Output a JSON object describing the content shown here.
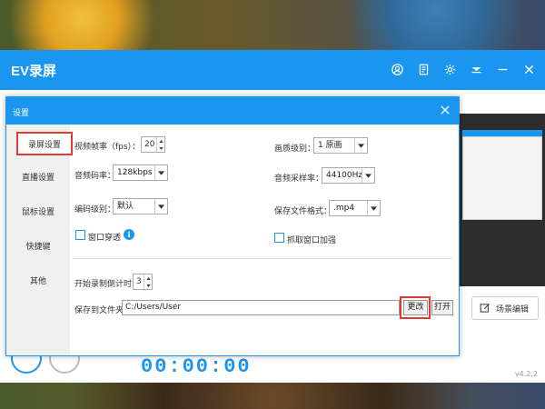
{
  "app": {
    "title": "EV录屏",
    "version": "v4.2.2",
    "scene_edit_label": "场景编辑",
    "timer": "00:00:00"
  },
  "dialog": {
    "title": "设置",
    "sidebar": [
      {
        "label": "录屏设置",
        "active": true
      },
      {
        "label": "直播设置",
        "active": false
      },
      {
        "label": "鼠标设置",
        "active": false
      },
      {
        "label": "快捷键",
        "active": false
      },
      {
        "label": "其他",
        "active": false
      }
    ],
    "fps": {
      "label": "视频帧率（fps）：",
      "value": "20"
    },
    "quality": {
      "label": "画质级别：",
      "value": "1 原画"
    },
    "audio_bitrate": {
      "label": "音频码率：",
      "value": "128kbps"
    },
    "sample_rate": {
      "label": "音频采样率：",
      "value": "44100Hz"
    },
    "encode_level": {
      "label": "编码级别：",
      "value": "默认"
    },
    "file_format": {
      "label": "保存文件格式：",
      "value": ".mp4"
    },
    "window_through": {
      "label": "窗口穿透",
      "checked": false
    },
    "capture_enhance": {
      "label": "抓取窗口加强",
      "checked": false
    },
    "countdown": {
      "label": "开始录制倒计时：",
      "value": "3"
    },
    "save_folder": {
      "label": "保存到文件夹：",
      "value": "C:/Users/User"
    },
    "change_label": "更改",
    "open_label": "打开"
  },
  "colors": {
    "accent": "#1a96f0",
    "highlight": "#e53935"
  }
}
